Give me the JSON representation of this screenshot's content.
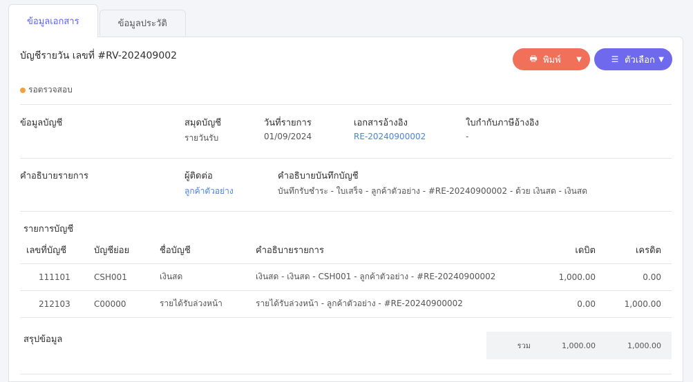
{
  "tabs": [
    {
      "label": "ข้อมูลเอกสาร",
      "active": true
    },
    {
      "label": "ข้อมูลประวัติ",
      "active": false
    }
  ],
  "document": {
    "title": "บัญชีรายวัน เลขที่ #RV-202409002",
    "status": "รอตรวจสอบ",
    "status_color": "#f5a03a"
  },
  "actions": {
    "print_label": "พิมพ์",
    "options_label": "ตัวเลือก",
    "print_color": "#f0705a",
    "options_color": "#6f69ee"
  },
  "account_info": {
    "section_label": "ข้อมูลบัญชี",
    "journal_label": "สมุดบัญชี",
    "journal_value": "รายวันรับ",
    "date_label": "วันที่รายการ",
    "date_value": "01/09/2024",
    "ref_doc_label": "เอกสารอ้างอิง",
    "ref_doc_value": "RE-20240900002",
    "tax_ref_label": "ใบกำกับภาษีอ้างอิง",
    "tax_ref_value": "-"
  },
  "description": {
    "section_label": "คำอธิบายรายการ",
    "contact_label": "ผู้ติดต่อ",
    "contact_value": "ลูกค้าตัวอย่าง",
    "note_label": "คำอธิบายบันทึกบัญชี",
    "note_value": "บันทึกรับชำระ - ใบเสร็จ - ลูกค้าตัวอย่าง - #RE-20240900002 - ด้วย เงินสด - เงินสด"
  },
  "ledger": {
    "section_label": "รายการบัญชี",
    "columns": [
      "เลขที่บัญชี",
      "บัญชีย่อย",
      "ชื่อบัญชี",
      "คำอธิบายรายการ",
      "เดบิต",
      "เครดิต"
    ],
    "rows": [
      {
        "account_no": "111101",
        "sub_account": "CSH001",
        "account_name": "เงินสด",
        "description": "เงินสด - เงินสด - CSH001 - ลูกค้าตัวอย่าง - #RE-20240900002",
        "debit": "1,000.00",
        "credit": "0.00"
      },
      {
        "account_no": "212103",
        "sub_account": "C00000",
        "account_name": "รายได้รับล่วงหน้า",
        "description": "รายได้รับล่วงหน้า - ลูกค้าตัวอย่าง - #RE-20240900002",
        "debit": "0.00",
        "credit": "1,000.00"
      }
    ]
  },
  "summary": {
    "section_label": "สรุปข้อมูล",
    "total_label": "รวม",
    "total_debit": "1,000.00",
    "total_credit": "1,000.00"
  }
}
